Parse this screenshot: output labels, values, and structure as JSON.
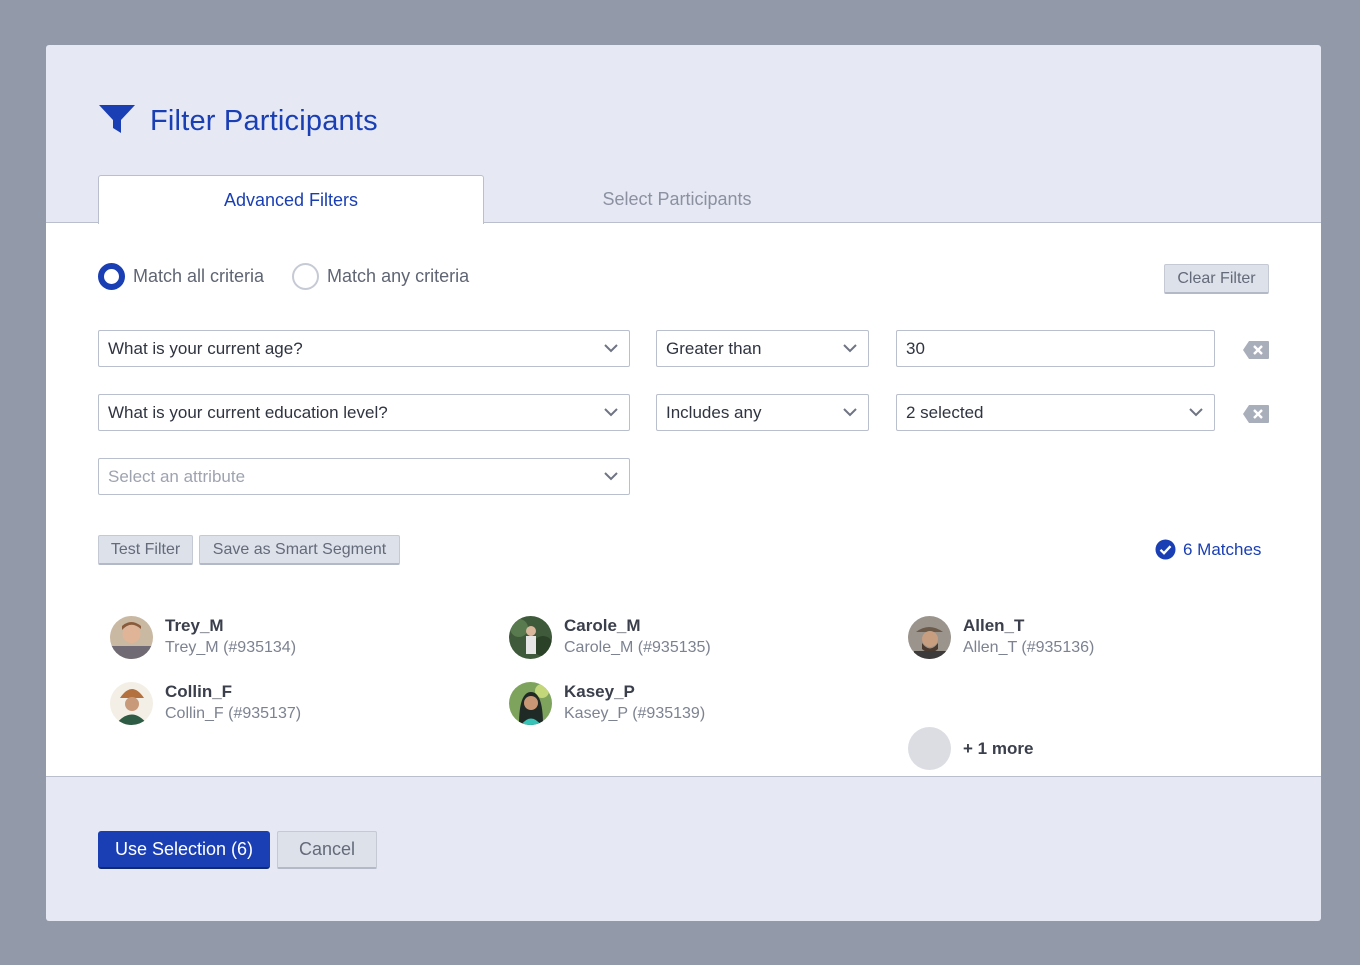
{
  "dialog": {
    "title": "Filter Participants"
  },
  "tabs": [
    {
      "label": "Advanced Filters",
      "active": true
    },
    {
      "label": "Select Participants",
      "active": false
    }
  ],
  "match_mode": {
    "options": [
      {
        "label": "Match all criteria",
        "selected": true
      },
      {
        "label": "Match any criteria",
        "selected": false
      }
    ],
    "clear_label": "Clear Filter"
  },
  "filters": [
    {
      "attribute": "What is your current age?",
      "operator": "Greater than",
      "value": "30"
    },
    {
      "attribute": "What is your current education level?",
      "operator": "Includes any",
      "value": "2 selected"
    }
  ],
  "new_filter": {
    "placeholder": "Select an attribute"
  },
  "actions": {
    "test_label": "Test Filter",
    "save_label": "Save as Smart Segment"
  },
  "results": {
    "matches_label": "6 Matches",
    "participants": [
      {
        "name": "Trey_M",
        "detail": "Trey_M (#935134)"
      },
      {
        "name": "Carole_M",
        "detail": "Carole_M (#935135)"
      },
      {
        "name": "Allen_T",
        "detail": "Allen_T (#935136)"
      },
      {
        "name": "Collin_F",
        "detail": "Collin_F (#935137)"
      },
      {
        "name": "Kasey_P",
        "detail": "Kasey_P (#935139)"
      }
    ],
    "more_label": "+ 1 more"
  },
  "footer": {
    "use_label": "Use Selection (6)",
    "cancel_label": "Cancel"
  },
  "colors": {
    "accent": "#1a3fb4",
    "backdrop": "#9299a8",
    "panel": "#e6e9f4"
  }
}
